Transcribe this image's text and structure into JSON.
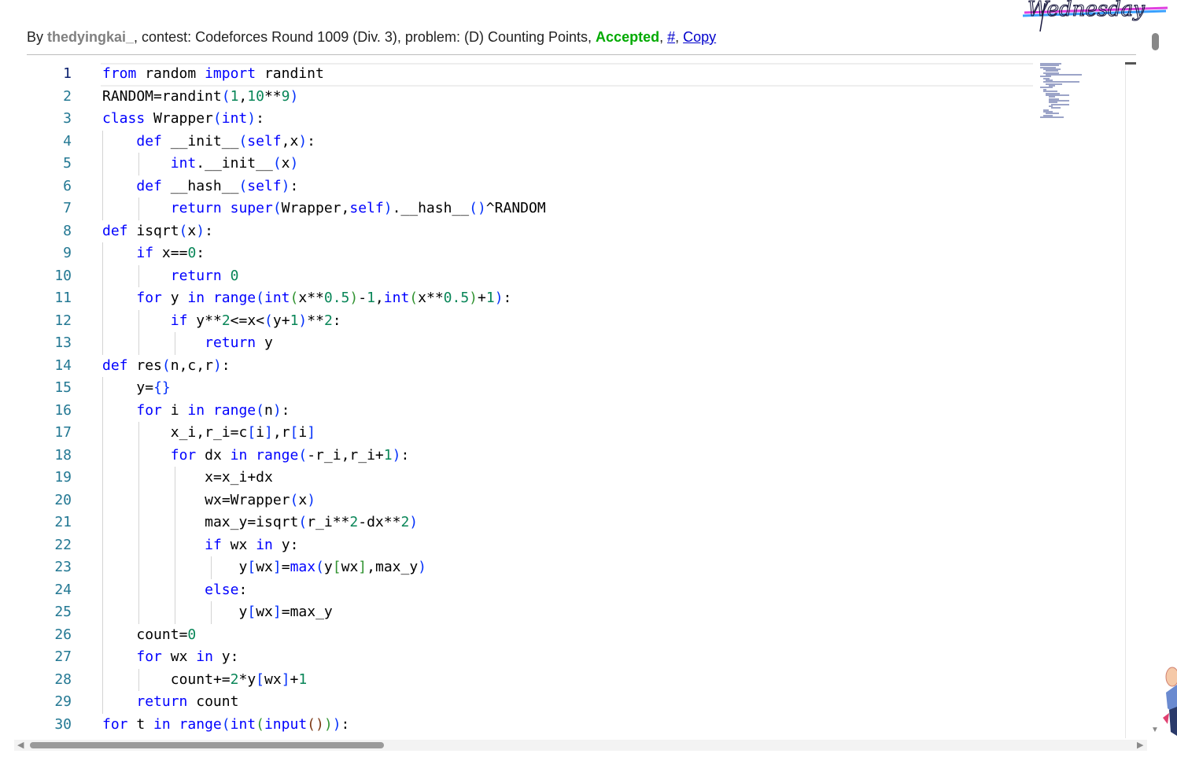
{
  "header": {
    "by_label": "By ",
    "username": "thedyingkai_",
    "contest_label": ", contest: ",
    "contest": "Codeforces Round 1009 (Div. 3)",
    "problem_label": ", problem: ",
    "problem": "(D) Counting Points",
    "sep1": ", ",
    "verdict": "Accepted",
    "sep2": ", ",
    "hash_link": "#",
    "sep3": ", ",
    "copy_link": "Copy"
  },
  "logo_text": "Wednesday",
  "colors": {
    "keyword": "#0000ff",
    "number": "#098658",
    "bracket_1": "#0431fa",
    "bracket_2": "#319331",
    "bracket_3": "#7b3814",
    "accepted": "#00aa00",
    "username": "#808080",
    "line_number": "#237893"
  },
  "editor": {
    "current_line": 1,
    "line_numbers": [
      "1",
      "2",
      "3",
      "4",
      "5",
      "6",
      "7",
      "8",
      "9",
      "10",
      "11",
      "12",
      "13",
      "14",
      "15",
      "16",
      "17",
      "18",
      "19",
      "20",
      "21",
      "22",
      "23",
      "24",
      "25",
      "26",
      "27",
      "28",
      "29",
      "30"
    ],
    "lines": [
      "from random import randint",
      "RANDOM=randint(1,10**9)",
      "class Wrapper(int):",
      "    def __init__(self,x):",
      "        int.__init__(x)",
      "    def __hash__(self):",
      "        return super(Wrapper,self).__hash__()^RANDOM",
      "def isqrt(x):",
      "    if x==0:",
      "        return 0",
      "    for y in range(int(x**0.5)-1,int(x**0.5)+1):",
      "        if y**2<=x<(y+1)**2:",
      "            return y",
      "def res(n,c,r):",
      "    y={}",
      "    for i in range(n):",
      "        x_i,r_i=c[i],r[i]",
      "        for dx in range(-r_i,r_i+1):",
      "            x=x_i+dx",
      "            wx=Wrapper(x)",
      "            max_y=isqrt(r_i**2-dx**2)",
      "            if wx in y:",
      "                y[wx]=max(y[wx],max_y)",
      "            else:",
      "                y[wx]=max_y",
      "    count=0",
      "    for wx in y:",
      "        count+=2*y[wx]+1",
      "    return count",
      "for t in range(int(input())):"
    ]
  }
}
